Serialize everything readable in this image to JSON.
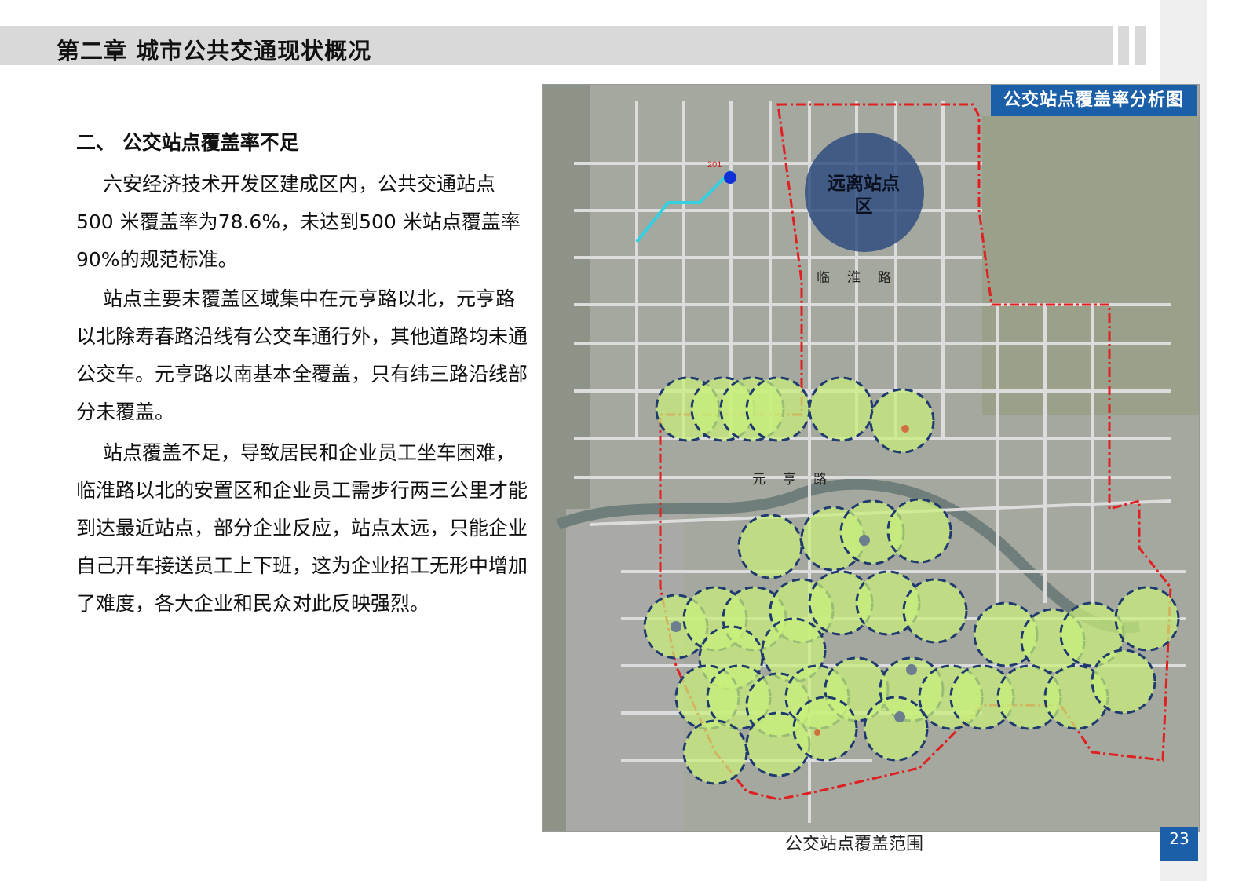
{
  "header": {
    "chapter_title": "第二章 城市公共交通现状概况"
  },
  "section": {
    "heading": "二、 公交站点覆盖率不足",
    "paragraphs": [
      "六安经济技术开发区建成区内，公共交通站点500 米覆盖率为78.6%，未达到500 米站点覆盖率90%的规范标准。",
      "站点主要未覆盖区域集中在元亨路以北，元亨路以北除寿春路沿线有公交车通行外，其他道路均未通公交车。元亨路以南基本全覆盖，只有纬三路沿线部分未覆盖。",
      "站点覆盖不足，导致居民和企业员工坐车困难，临淮路以北的安置区和企业员工需步行两三公里才能到达最近站点，部分企业反应，站点太远，只能企业自己开车接送员工上下班，这为企业招工无形中增加了难度，各大企业和民众对此反映强烈。"
    ]
  },
  "map": {
    "title": "公交站点覆盖率分析图",
    "far_zone_label": "远离站点区",
    "road_labels": [
      "临淮路",
      "元亨路"
    ],
    "station_marker": "201",
    "caption": "公交站点覆盖范围",
    "colors": {
      "coverage_fill": "#c9f07a",
      "coverage_stroke": "#1f3a6e",
      "boundary": "#e02020",
      "far_zone": "#2c4a7e",
      "badge": "#1a5fa8"
    }
  },
  "page_number": "23"
}
